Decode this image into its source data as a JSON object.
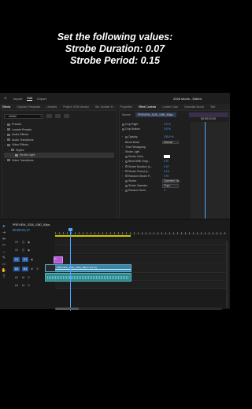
{
  "caption": {
    "line1": "Set the following values:",
    "line2": "Strobe Duration: 0.07",
    "line3": "Strobe Period: 0.15"
  },
  "header": {
    "modes": [
      "Import",
      "Edit",
      "Export"
    ],
    "active_mode": "Edit",
    "doc_title": "2026 shorts - Edited"
  },
  "tabs": [
    "Effects",
    "Graphics Templates",
    "Libraries",
    "Project: 2026 shorts.p",
    "Bin: Another 10",
    "Properties",
    "Effect Controls",
    "Lumetri Color",
    "Essential Sound",
    "Text"
  ],
  "effects_panel": {
    "search_value": "strobe",
    "tree": [
      {
        "label": "Presets",
        "level": 0
      },
      {
        "label": "Lumetri Presets",
        "level": 0
      },
      {
        "label": "Audio Effects",
        "level": 0
      },
      {
        "label": "Audio Transitions",
        "level": 0
      },
      {
        "label": "Video Effects",
        "level": 0
      },
      {
        "label": "Stylize",
        "level": 1
      },
      {
        "label": "Strobe Light",
        "level": 2
      },
      {
        "label": "Video Transitions",
        "level": 0
      }
    ]
  },
  "effect_controls": {
    "source_label": "Source",
    "clip_label": "PREVIEW_2026_1080_30fps",
    "timecode": "00:00:01:00",
    "properties": [
      {
        "label": "Crop Right",
        "value": "0.0 %"
      },
      {
        "label": "Crop Bottom",
        "value": "0.0 %"
      },
      {
        "label": "Opacity",
        "value": "100.0 %"
      },
      {
        "label": "Blend Mode",
        "dropdown": "Normal"
      },
      {
        "label": "Time Remapping",
        "value": ""
      },
      {
        "label": "Strobe Light",
        "value": ""
      },
      {
        "label": "Strobe Color",
        "value": ""
      },
      {
        "label": "Blend With Origi...",
        "value": "0 %"
      },
      {
        "label": "Strobe Duration (s...",
        "value": "0.07"
      },
      {
        "label": "Strobe Period (s...",
        "value": "0.15"
      },
      {
        "label": "Random Strobe P...",
        "value": "0 %"
      },
      {
        "label": "Strobe",
        "dropdown": "Operates On..."
      },
      {
        "label": "Strobe Operator",
        "dropdown": "Copy"
      },
      {
        "label": "Random Seed",
        "value": "0"
      }
    ],
    "footer_time": "00:00:01:17"
  },
  "timeline": {
    "sequence_name": "PREVIEW_2026_1080_30fps",
    "timecode": "00:00:01:17",
    "tracks": [
      "V3",
      "V2",
      "V1",
      "A1",
      "A2",
      "A3"
    ],
    "clip_fx_label": "fx",
    "clip_video_label": "PREVIEW_2026_1080_30fps.mp4 [V]"
  }
}
